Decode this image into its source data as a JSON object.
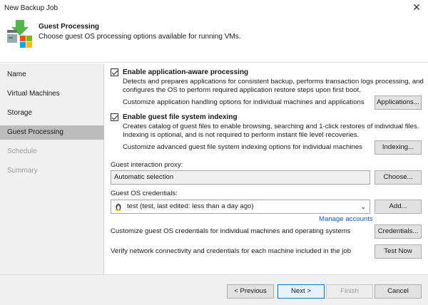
{
  "window": {
    "title": "New Backup Job",
    "close_glyph": "✕"
  },
  "header": {
    "title": "Guest Processing",
    "description": "Choose guest OS processing options available for running VMs.",
    "logo_icon": "backup-job-logo-icon"
  },
  "sidebar": {
    "items": [
      {
        "label": "Name",
        "state": "normal"
      },
      {
        "label": "Virtual Machines",
        "state": "normal"
      },
      {
        "label": "Storage",
        "state": "normal"
      },
      {
        "label": "Guest Processing",
        "state": "active"
      },
      {
        "label": "Schedule",
        "state": "disabled"
      },
      {
        "label": "Summary",
        "state": "disabled"
      }
    ]
  },
  "app_aware": {
    "checked": true,
    "label": "Enable application-aware processing",
    "desc_line1": "Detects and prepares applications for consistent backup, performs transaction logs processing, and",
    "desc_line2": "configures the OS to perform required application restore steps upon first boot.",
    "customize_text": "Customize application handling options for individual machines and applications",
    "button_label": "Applications..."
  },
  "file_indexing": {
    "checked": true,
    "label": "Enable guest file system indexing",
    "desc_line1": "Creates catalog of guest files to enable browsing, searching and 1-click restores of individual files.",
    "desc_line2": "Indexing is optional, and is not required to perform instant file level recoveries.",
    "customize_text": "Customize advanced guest file system indexing options for individual machines",
    "button_label": "Indexing..."
  },
  "proxy": {
    "label": "Guest interaction proxy:",
    "value": "Automatic selection",
    "button_label": "Choose..."
  },
  "credentials": {
    "label": "Guest OS credentials:",
    "value": "test (test, last edited: less than a day ago)",
    "add_label": "Add...",
    "manage_link": "Manage accounts",
    "customize_text": "Customize guest OS credentials for individual machines and operating systems",
    "credentials_button": "Credentials..."
  },
  "verify": {
    "text": "Verify network connectivity and credentials for each machine included in the job",
    "button_label": "Test Now"
  },
  "footer": {
    "previous": "< Previous",
    "next": "Next >",
    "finish": "Finish",
    "cancel": "Cancel"
  },
  "colors": {
    "accent": "#0078d7",
    "link": "#1a56c8",
    "sidebar_active": "#bcbcbc"
  }
}
